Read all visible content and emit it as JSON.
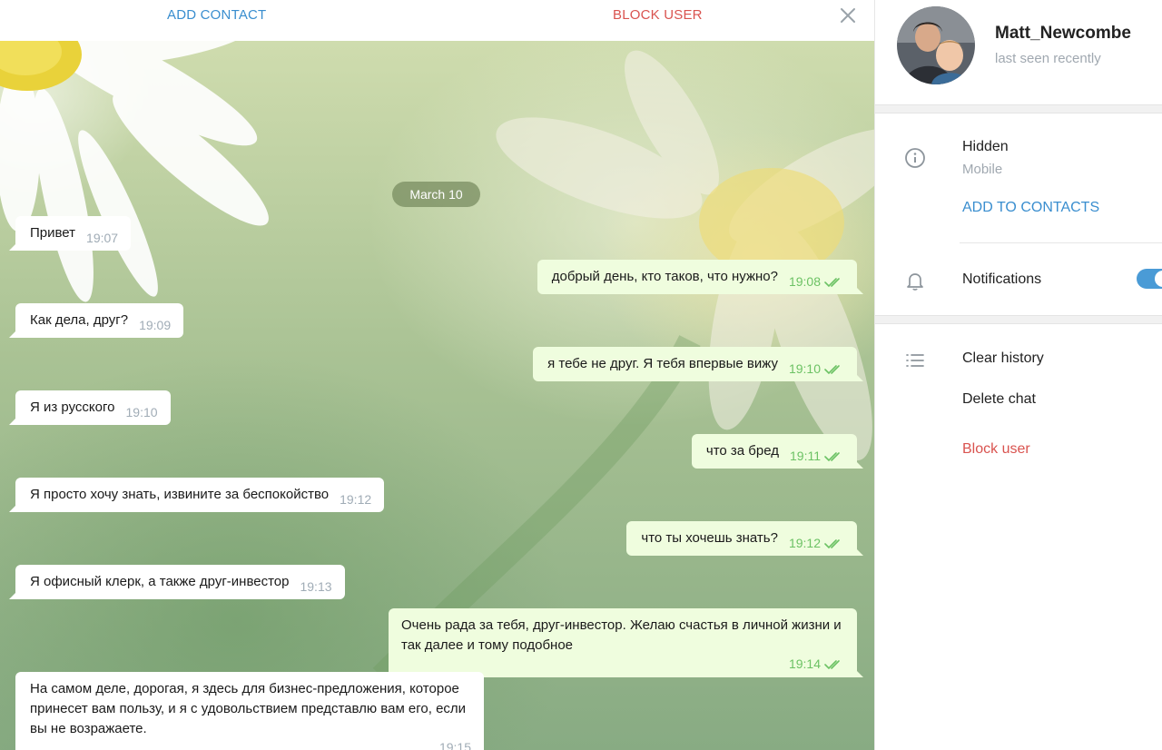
{
  "header": {
    "add_contact": "ADD CONTACT",
    "block_user": "BLOCK USER"
  },
  "chat": {
    "date": "March 10",
    "messages": [
      {
        "dir": "in",
        "text": "Привет",
        "time": "19:07"
      },
      {
        "dir": "out",
        "text": "добрый день, кто таков, что нужно?",
        "time": "19:08"
      },
      {
        "dir": "in",
        "text": "Как дела, друг?",
        "time": "19:09"
      },
      {
        "dir": "out",
        "text": "я тебе не друг. Я тебя впервые вижу",
        "time": "19:10"
      },
      {
        "dir": "in",
        "text": "Я из русского",
        "time": "19:10"
      },
      {
        "dir": "out",
        "text": "что за бред",
        "time": "19:11"
      },
      {
        "dir": "in",
        "text": "Я просто хочу знать, извините за беспокойство",
        "time": "19:12"
      },
      {
        "dir": "out",
        "text": "что ты хочешь знать?",
        "time": "19:12"
      },
      {
        "dir": "in",
        "text": "Я офисный клерк, а также друг-инвестор",
        "time": "19:13"
      },
      {
        "dir": "out",
        "text": "Очень рада за тебя, друг-инвестор. Желаю счастья в личной жизни и так далее и тому подобное",
        "time": "19:14"
      },
      {
        "dir": "in",
        "text": "На самом деле, дорогая, я здесь для бизнес-предложения, которое принесет вам пользу, и я с удовольствием представлю вам его, если вы не возражаете.",
        "time": "19:15"
      }
    ]
  },
  "profile": {
    "name": "Matt_Newcombe",
    "status": "last seen recently",
    "phone_label": "Hidden",
    "phone_sub": "Mobile",
    "add_to_contacts": "ADD TO CONTACTS",
    "notifications_label": "Notifications",
    "notifications_on": true,
    "clear_history": "Clear history",
    "delete_chat": "Delete chat",
    "block_user": "Block user"
  },
  "colors": {
    "accent": "#3a8ecf",
    "danger": "#d9534f",
    "outgoing_bubble": "#effdde",
    "read_check": "#6cc264"
  },
  "icons": [
    "close-icon",
    "info-icon",
    "bell-icon",
    "list-icon",
    "double-check-icon"
  ]
}
